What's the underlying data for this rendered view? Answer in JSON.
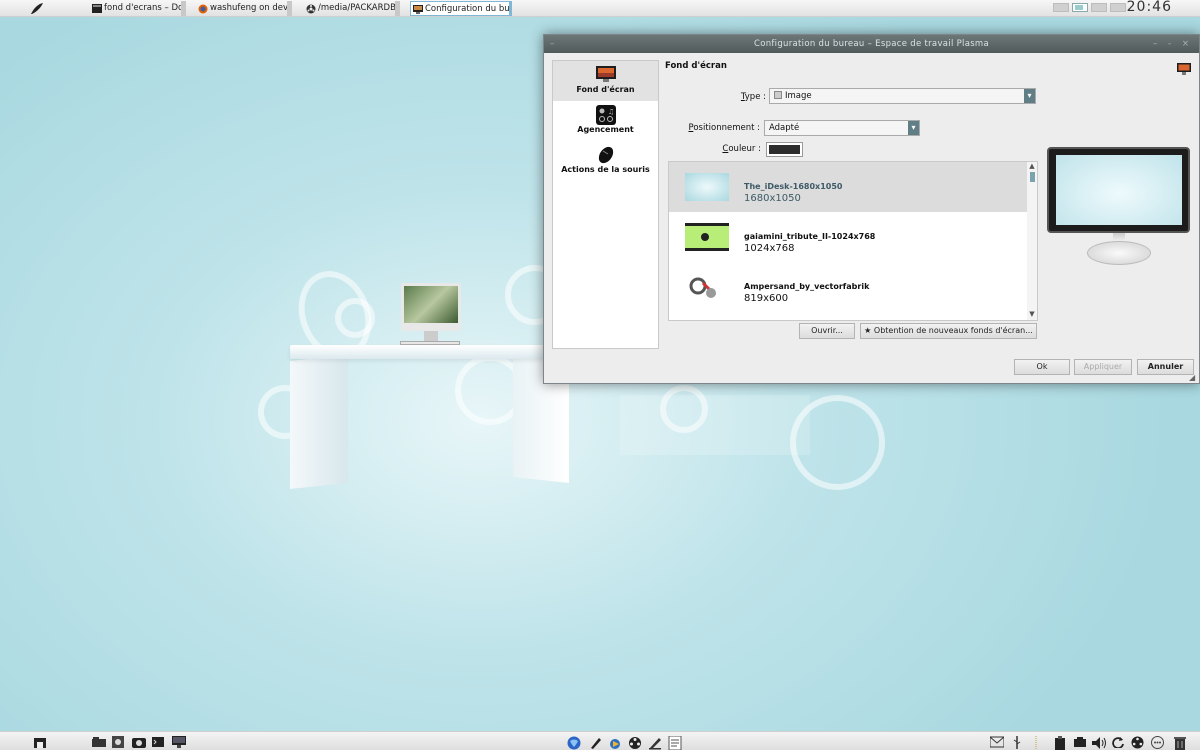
{
  "top_panel": {
    "tasks": [
      {
        "label": "fond d'ecrans – Dolp",
        "icon": "terminal-icon"
      },
      {
        "label": "washufeng on devia",
        "icon": "firefox-icon"
      },
      {
        "label": "/media/PACKARDBE",
        "icon": "film-reel-icon"
      },
      {
        "label": "Configuration du bur",
        "icon": "monitor-icon",
        "active": true
      }
    ],
    "clock": "20:46"
  },
  "dialog": {
    "title": "Configuration du bureau – Espace de travail Plasma",
    "title_left": "–",
    "title_right": "– ‑ ×",
    "sidebar": [
      {
        "label": "Fond d'écran",
        "icon": "wallpaper-icon",
        "selected": true
      },
      {
        "label": "Agencement",
        "icon": "layout-icon"
      },
      {
        "label": "Actions de la souris",
        "icon": "mouse-icon"
      }
    ],
    "section_title": "Fond d'écran",
    "type": {
      "label_prefix": "T",
      "label_rest": "ype :",
      "value": "Image"
    },
    "positionnement": {
      "label_prefix": "P",
      "label_rest": "ositionnement :",
      "value": "Adapté"
    },
    "couleur": {
      "label_prefix": "C",
      "label_rest": "ouleur :",
      "color": "#2c2c2c"
    },
    "wallpapers": [
      {
        "name": "The_iDesk-1680x1050",
        "size": "1680x1050",
        "selected": true
      },
      {
        "name": "gaiamini_tribute_II-1024x768",
        "size": "1024x768"
      },
      {
        "name": "Ampersand_by_vectorfabrik",
        "size": "819x600"
      }
    ],
    "scroll_up": "▲",
    "scroll_down": "▼",
    "ouvrir_button": "Ouvrir...",
    "obtention_button": "Obtention de nouveaux fonds d'écran...",
    "ok_button": "Ok",
    "appliquer_button": "Appliquer",
    "annuler_button": "Annuler"
  },
  "colors": {
    "desktop": "#bfe4ea",
    "titlebar": "#5f6a6b",
    "accent": "#5f7e86"
  }
}
